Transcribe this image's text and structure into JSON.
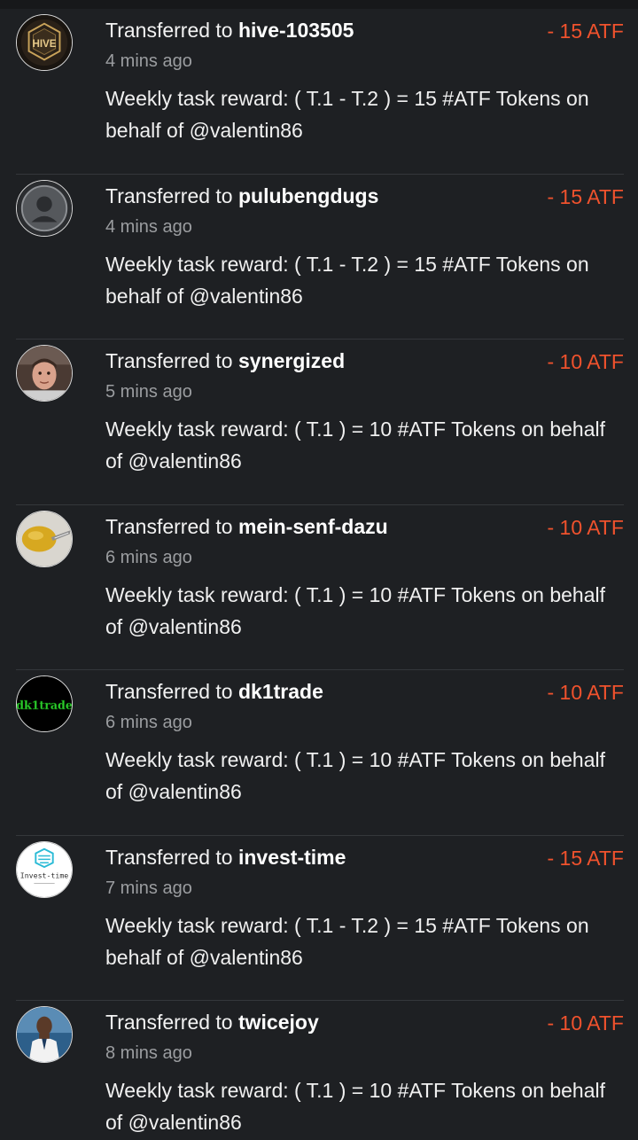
{
  "transfers": [
    {
      "prefix": "Transferred to ",
      "user": "hive-103505",
      "amount": "- 15 ATF",
      "time": "4 mins ago",
      "memo": "Weekly task reward: ( T.1 - T.2 ) = 15 #ATF Tokens on behalf of @valentin86",
      "avatar_icon": "hive-logo-icon",
      "avatar_text": "HIVE"
    },
    {
      "prefix": "Transferred to ",
      "user": "pulubengdugs",
      "amount": "- 15 ATF",
      "time": "4 mins ago",
      "memo": "Weekly task reward: ( T.1 - T.2 ) = 15 #ATF Tokens on behalf of @valentin86",
      "avatar_icon": "default-user-icon"
    },
    {
      "prefix": "Transferred to ",
      "user": "synergized",
      "amount": "- 10 ATF",
      "time": "5 mins ago",
      "memo": "Weekly task reward: ( T.1 ) = 10 #ATF Tokens on behalf of @valentin86",
      "avatar_icon": "face-photo-icon"
    },
    {
      "prefix": "Transferred to ",
      "user": "mein-senf-dazu",
      "amount": "- 10 ATF",
      "time": "6 mins ago",
      "memo": "Weekly task reward: ( T.1 ) = 10 #ATF Tokens on behalf of @valentin86",
      "avatar_icon": "mustard-photo-icon"
    },
    {
      "prefix": "Transferred to ",
      "user": "dk1trade",
      "amount": "- 10 ATF",
      "time": "6 mins ago",
      "memo": "Weekly task reward: ( T.1 ) = 10 #ATF Tokens on behalf of @valentin86",
      "avatar_icon": "dk1trade-logo-icon",
      "avatar_text": "dk1trade"
    },
    {
      "prefix": "Transferred to ",
      "user": "invest-time",
      "amount": "- 15 ATF",
      "time": "7 mins ago",
      "memo": "Weekly task reward: ( T.1 - T.2 ) = 15 #ATF Tokens on behalf of @valentin86",
      "avatar_icon": "invest-time-logo-icon",
      "avatar_text": "Invest-time"
    },
    {
      "prefix": "Transferred to ",
      "user": "twicejoy",
      "amount": "- 10 ATF",
      "time": "8 mins ago",
      "memo": "Weekly task reward: ( T.1 ) = 10 #ATF Tokens on behalf of @valentin86",
      "avatar_icon": "person-photo-icon"
    }
  ],
  "colors": {
    "background": "#1e2023",
    "amount_negative": "#f0522d",
    "divider": "#34373b",
    "muted_text": "#9b9da0"
  }
}
